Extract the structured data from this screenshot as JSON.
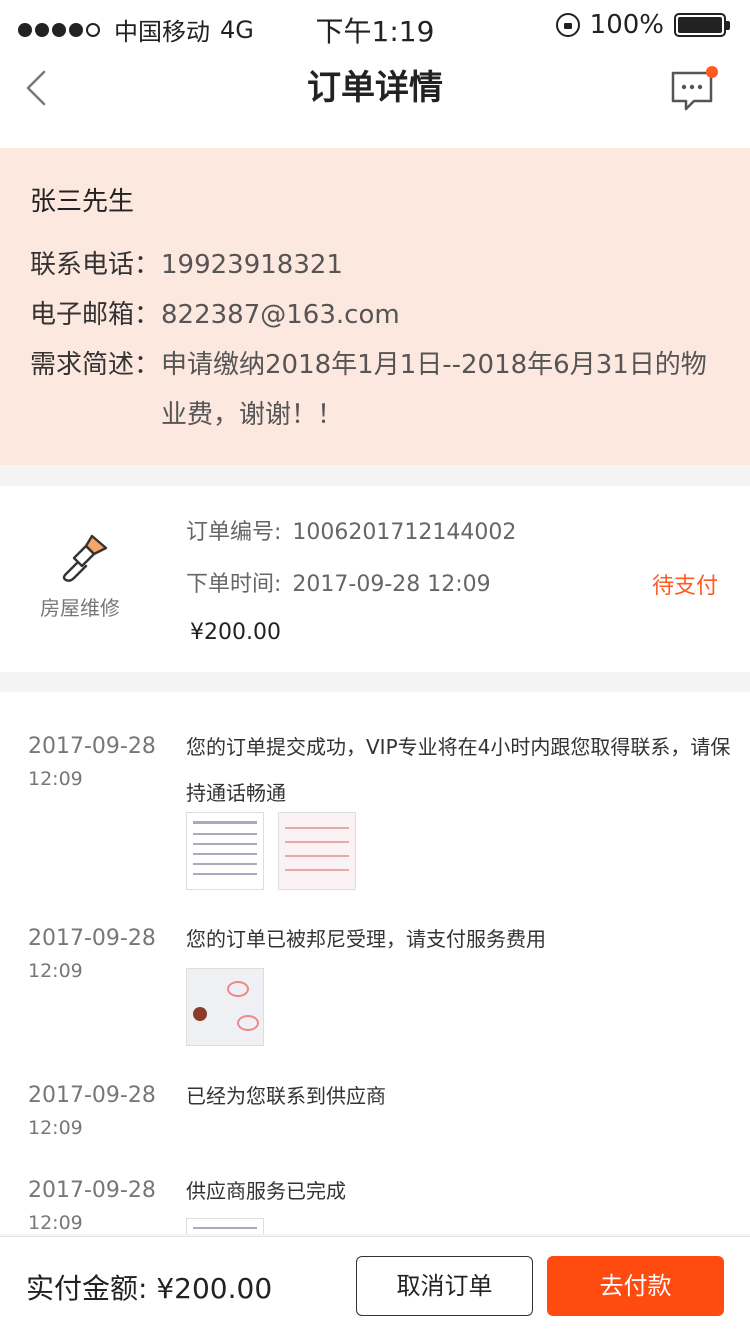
{
  "status_bar": {
    "carrier": "中国移动",
    "network": "4G",
    "time": "下午1:19",
    "battery": "100%"
  },
  "nav": {
    "title": "订单详情",
    "back_icon": "chevron-left-icon",
    "message_icon": "chat-bubble-icon",
    "has_unread": true
  },
  "customer": {
    "name": "张三先生",
    "phone_label": "联系电话：",
    "phone": "19923918321",
    "email_label": "电子邮箱：",
    "email": "822387@163.com",
    "desc_label": "需求简述：",
    "desc": "申请缴纳2018年1月1日--2018年6月31日的物业费，谢谢！！"
  },
  "order": {
    "service_icon": "paint-brush-icon",
    "service_name": "房屋维修",
    "number_label": "订单编号:",
    "number": "1006201712144002",
    "time_label": "下单时间:",
    "time": "2017-09-28 12:09",
    "status": "待支付",
    "price": "¥200.00"
  },
  "timeline": [
    {
      "date": "2017-09-28",
      "time": "12:09",
      "text": "您的订单提交成功，VIP专业将在4小时内跟您取得联系，请保持通话畅通",
      "images": [
        "document-scan",
        "invoice-scan"
      ]
    },
    {
      "date": "2017-09-28",
      "time": "12:09",
      "text": "您的订单已被邦尼受理，请支付服务费用",
      "images": [
        "photo-document"
      ]
    },
    {
      "date": "2017-09-28",
      "time": "12:09",
      "text": "已经为您联系到供应商",
      "images": []
    },
    {
      "date": "2017-09-28",
      "time": "12:09",
      "text": "供应商服务已完成",
      "images": [
        "document-scan"
      ]
    }
  ],
  "footer": {
    "total_label": "实付金额:",
    "total": "¥200.00",
    "cancel_label": "取消订单",
    "pay_label": "去付款"
  },
  "colors": {
    "accent": "#ff4a10",
    "status": "#ff5a1f",
    "customer_bg": "#fde8df"
  }
}
